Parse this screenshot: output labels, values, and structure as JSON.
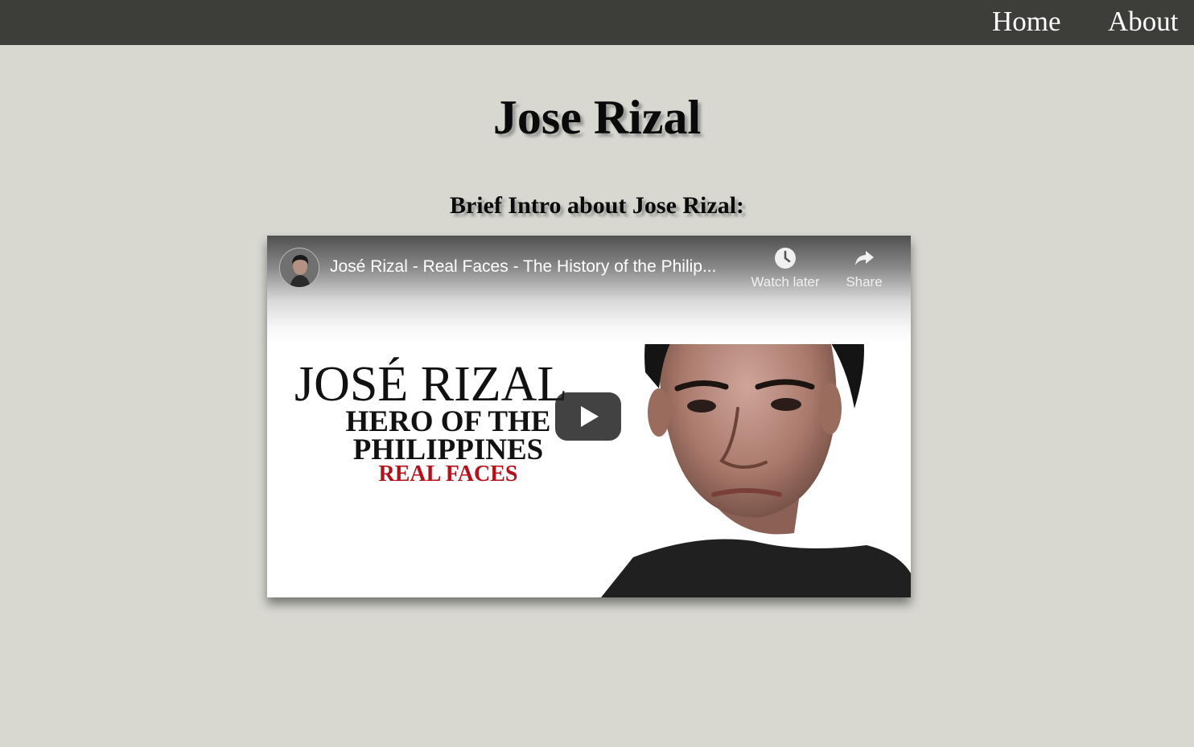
{
  "nav": {
    "home_label": "Home",
    "about_label": "About"
  },
  "page": {
    "title": "Jose Rizal",
    "subtitle": "Brief Intro about Jose Rizal:"
  },
  "video": {
    "title": "José Rizal - Real Faces - The History of the Philip...",
    "watch_later_label": "Watch later",
    "share_label": "Share",
    "thumbnail": {
      "name_line": "JOSÉ RIZAL",
      "line1": "HERO OF THE",
      "line2": "PHILIPPINES",
      "line3": "REAL FACES"
    },
    "icons": {
      "watch_later": "clock-icon",
      "share": "share-arrow-icon",
      "play": "play-icon"
    }
  },
  "colors": {
    "background": "#d8d8d1",
    "navbar": "#3d3e3a",
    "play_button": "#212121",
    "promo_red": "#b3121a"
  }
}
